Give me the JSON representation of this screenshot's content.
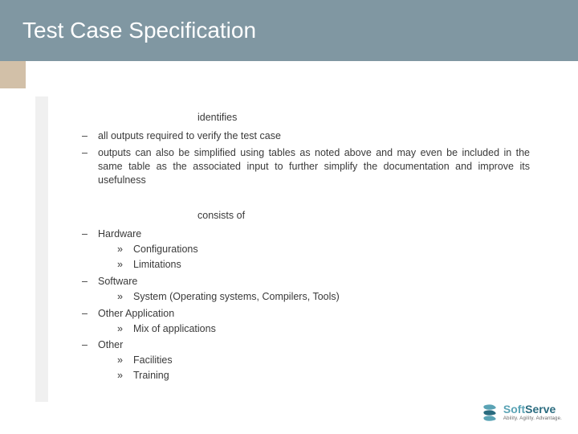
{
  "title": "Test Case Specification",
  "section1": {
    "label": "identifies",
    "items": [
      "all outputs required to verify the test case",
      "outputs can also be simplified using tables as noted above and may even be included in the same table as the associated input to further simplify the documentation and improve its usefulness"
    ]
  },
  "section2": {
    "label": "consists of",
    "groups": [
      {
        "label": "Hardware",
        "subs": [
          "Configurations",
          "Limitations"
        ]
      },
      {
        "label": "Software",
        "subs": [
          "System (Operating systems, Compilers, Tools)"
        ]
      },
      {
        "label": "Other Application",
        "subs": [
          "Mix of applications"
        ]
      },
      {
        "label": "Other",
        "subs": [
          "Facilities",
          "Training"
        ]
      }
    ]
  },
  "logo": {
    "name_part1": "Soft",
    "name_part2": "Serve",
    "tagline": "Ability. Agility. Advantage."
  }
}
